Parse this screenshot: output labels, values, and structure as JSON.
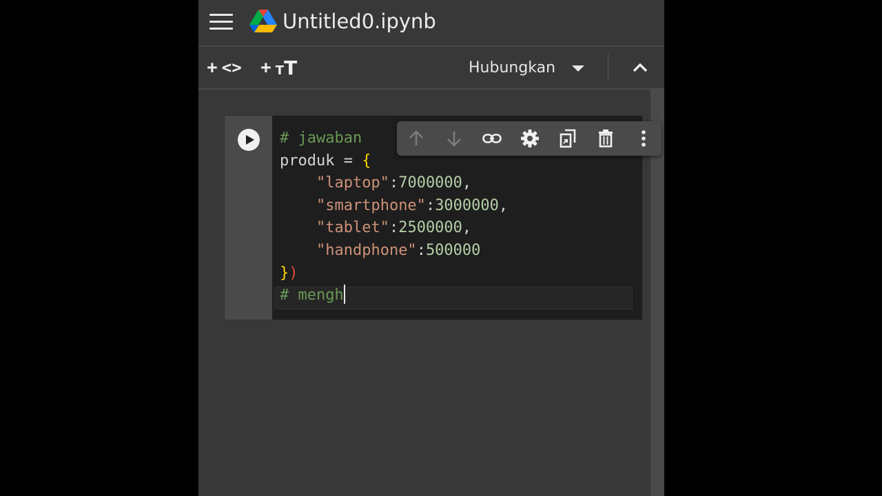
{
  "app": {
    "title": "Untitled0.ipynb",
    "icons": {
      "menu": "hamburger-menu-icon",
      "logo": "google-drive-logo"
    }
  },
  "toolbar": {
    "add_code": {
      "plus": "+",
      "glyph": "<>"
    },
    "add_text": {
      "plus": "+",
      "glyph_small": "T",
      "glyph_big": "T"
    },
    "connect_label": "Hubungkan",
    "icons": {
      "connect_dropdown": "caret-down-icon",
      "collapse": "chevron-up-icon"
    }
  },
  "cell_toolbar": {
    "icons": [
      "arrow-up-icon",
      "arrow-down-icon",
      "link-icon",
      "gear-icon",
      "mirror-cell-icon",
      "trash-icon",
      "more-vert-icon"
    ]
  },
  "cell": {
    "run_icon": "play-circle-icon",
    "code": {
      "line1": "# jawaban",
      "line2_a": "produk = ",
      "line2_brace": "{",
      "items": [
        {
          "indent": "    ",
          "key": "\"laptop\"",
          "colon": ":",
          "value": "7000000",
          "comma": ","
        },
        {
          "indent": "    ",
          "key": "\"smartphone\"",
          "colon": ":",
          "value": "3000000",
          "comma": ","
        },
        {
          "indent": "    ",
          "key": "\"tablet\"",
          "colon": ":",
          "value": "2500000",
          "comma": ","
        },
        {
          "indent": "    ",
          "key": "\"handphone\"",
          "colon": ":",
          "value": "500000",
          "comma": ""
        }
      ],
      "close_brace": "}",
      "close_paren": ")",
      "line_last": "# mengh"
    }
  },
  "colors": {
    "background": "#383838",
    "editor": "#1e1e1e",
    "comment": "#6a9955",
    "string": "#ce9178",
    "number": "#b5cea8",
    "brace": "#ffd700",
    "error": "#e04a3a"
  }
}
